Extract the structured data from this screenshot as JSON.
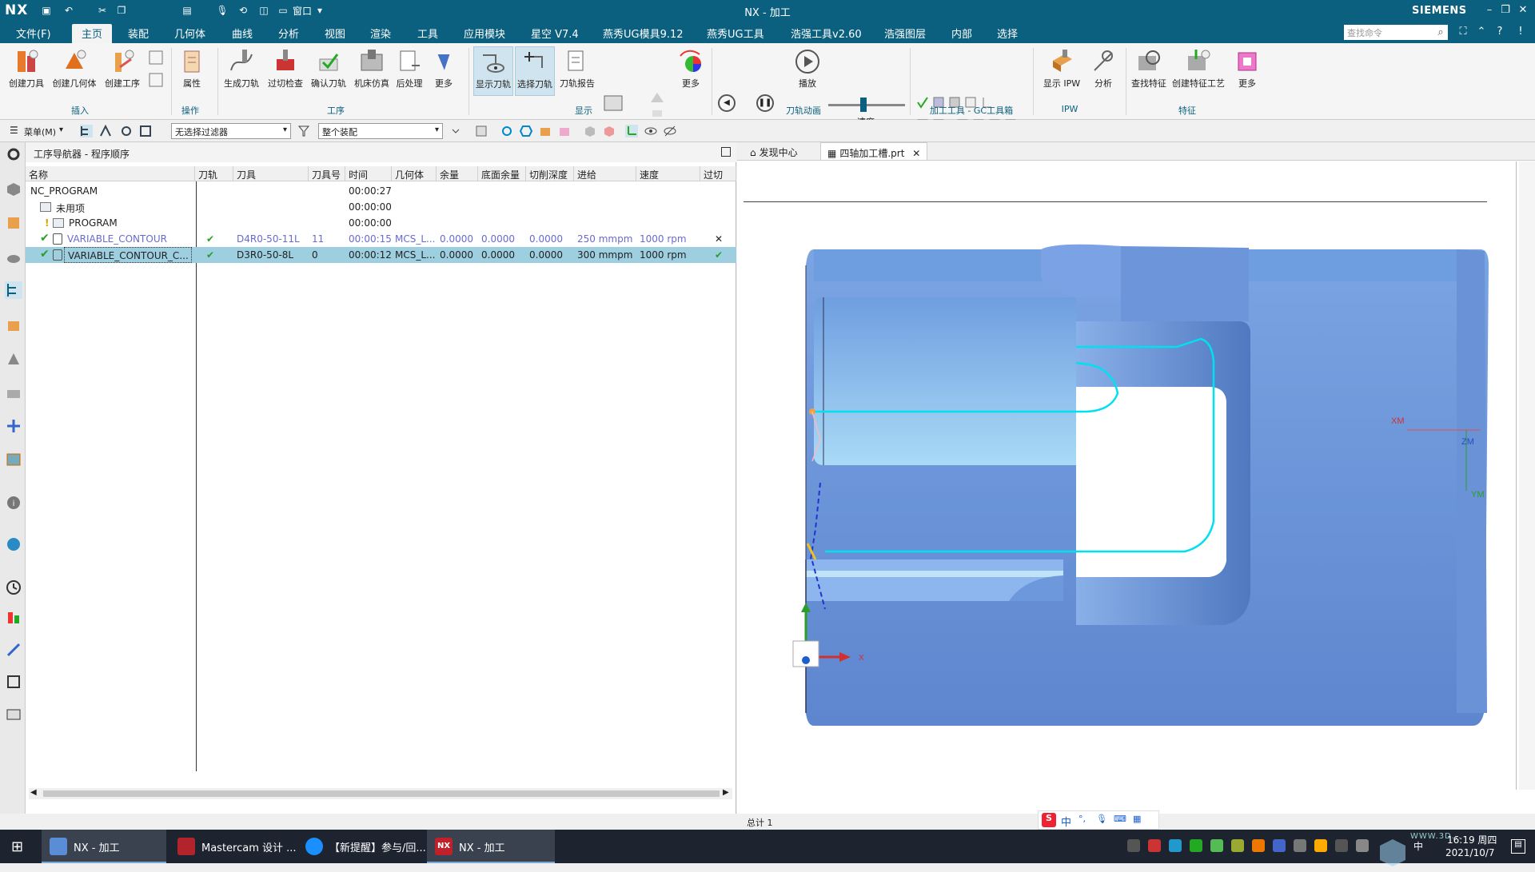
{
  "titlebar": {
    "logo": "NX",
    "title": "NX - 加工",
    "brand": "SIEMENS",
    "window_menu": "窗口"
  },
  "menubar": {
    "items": [
      "文件(F)",
      "主页",
      "装配",
      "几何体",
      "曲线",
      "分析",
      "视图",
      "渲染",
      "工具",
      "应用模块",
      "星空 V7.4",
      "燕秀UG模具9.12",
      "燕秀UG工具",
      "浩强工具v2.60",
      "浩强图层",
      "内部",
      "选择"
    ],
    "search_placeholder": "查找命令"
  },
  "ribbon": {
    "buttons": [
      "创建刀具",
      "创建几何体",
      "创建工序",
      "属性",
      "生成刀轨",
      "过切检查",
      "确认刀轨",
      "机床仿真",
      "后处理",
      "更多",
      "显示刀轨",
      "选择刀轨",
      "刀轨报告",
      "更多",
      "播放",
      "速度",
      "显示 IPW",
      "分析",
      "查找特征",
      "创建特征工艺",
      "更多"
    ],
    "groups": [
      "插入",
      "操作",
      "工序",
      "显示",
      "刀轨动画",
      "加工工具 - GC工具箱",
      "IPW",
      "特征"
    ]
  },
  "toolbar2": {
    "menu_label": "菜单(M)",
    "filter": "无选择过滤器",
    "scope": "整个装配"
  },
  "navigator": {
    "title": "工序导航器 - 程序顺序",
    "columns": [
      "名称",
      "刀轨",
      "刀具",
      "刀具号",
      "时间",
      "几何体",
      "余量",
      "底面余量",
      "切削深度",
      "进给",
      "速度",
      "过切"
    ],
    "rows": [
      {
        "name": "NC_PROGRAM",
        "path": "",
        "tool": "",
        "toolno": "",
        "time": "00:00:27",
        "geom": "",
        "stock": "",
        "floor": "",
        "depth": "",
        "feed": "",
        "speed": "",
        "gouge": ""
      },
      {
        "name": "未用项",
        "path": "",
        "tool": "",
        "toolno": "",
        "time": "00:00:00",
        "geom": "",
        "stock": "",
        "floor": "",
        "depth": "",
        "feed": "",
        "speed": "",
        "gouge": ""
      },
      {
        "name": "PROGRAM",
        "path": "",
        "tool": "",
        "toolno": "",
        "time": "00:00:00",
        "geom": "",
        "stock": "",
        "floor": "",
        "depth": "",
        "feed": "",
        "speed": "",
        "gouge": ""
      },
      {
        "name": "VARIABLE_CONTOUR",
        "path": "✔",
        "tool": "D4R0-50-11L",
        "toolno": "11",
        "time": "00:00:15",
        "geom": "MCS_L...",
        "stock": "0.0000",
        "floor": "0.0000",
        "depth": "0.0000",
        "feed": "250 mmpm",
        "speed": "1000 rpm",
        "gouge": "✕"
      },
      {
        "name": "VARIABLE_CONTOUR_C...",
        "path": "✔",
        "tool": "D3R0-50-8L",
        "toolno": "0",
        "time": "00:00:12",
        "geom": "MCS_L...",
        "stock": "0.0000",
        "floor": "0.0000",
        "depth": "0.0000",
        "feed": "300 mmpm",
        "speed": "1000 rpm",
        "gouge": "✔"
      }
    ]
  },
  "viewport": {
    "tabs": [
      "发现中心",
      "四轴加工槽.prt"
    ],
    "axis_labels": {
      "xm": "XM",
      "zm": "ZM",
      "ym": "YM",
      "x": "X"
    }
  },
  "status": {
    "text": "总计 1"
  },
  "taskbar": {
    "items": [
      "NX - 加工",
      "Mastercam 设计 ...",
      "【新提醒】参与/回...",
      "NX - 加工"
    ],
    "time": "16:19 周四",
    "date": "2021/10/7",
    "ime": "中",
    "watermark": "WWW.3D..."
  },
  "colors": {
    "titlebar": "#0b5f7f",
    "part": "#6f9ee0",
    "toolpath": "#00e0f0"
  }
}
